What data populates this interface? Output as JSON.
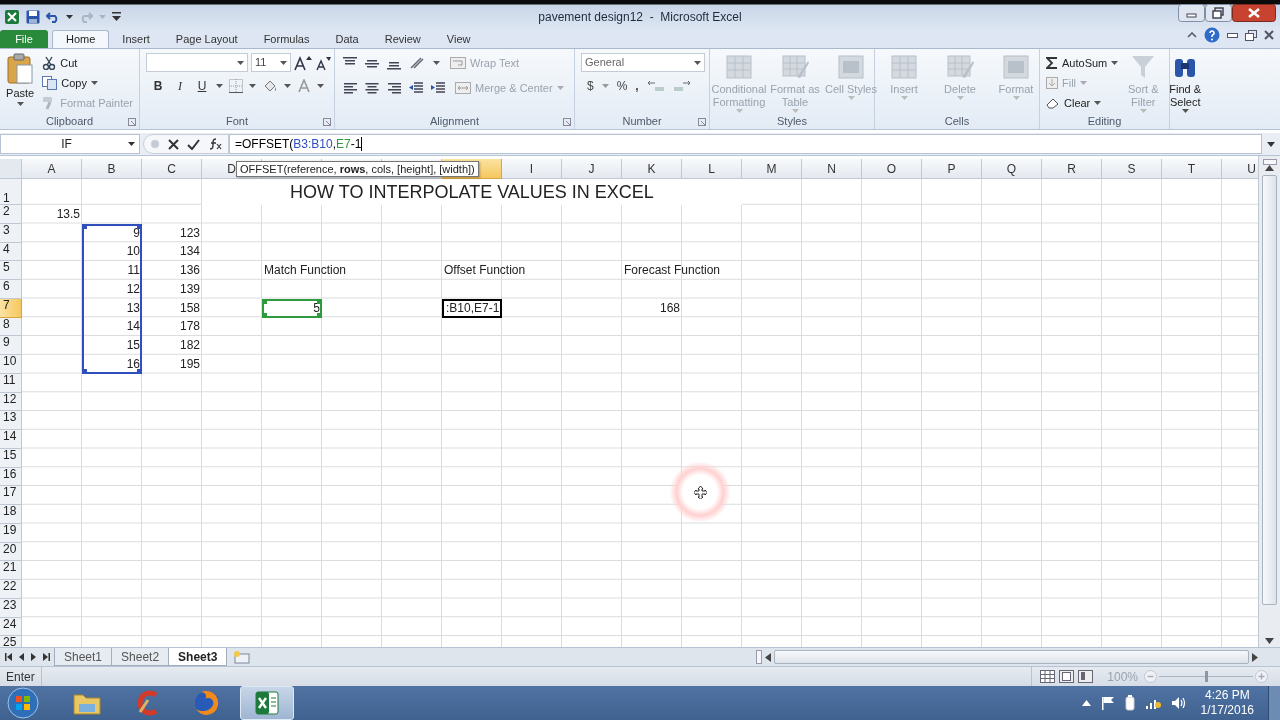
{
  "window": {
    "title": "pavement design12  -  Microsoft Excel"
  },
  "ribbon_tabs": [
    {
      "label": "File",
      "kind": "file",
      "selected": false
    },
    {
      "label": "Home",
      "kind": "tab",
      "selected": true
    },
    {
      "label": "Insert",
      "kind": "tab",
      "selected": false
    },
    {
      "label": "Page Layout",
      "kind": "tab",
      "selected": false
    },
    {
      "label": "Formulas",
      "kind": "tab",
      "selected": false
    },
    {
      "label": "Data",
      "kind": "tab",
      "selected": false
    },
    {
      "label": "Review",
      "kind": "tab",
      "selected": false
    },
    {
      "label": "View",
      "kind": "tab",
      "selected": false
    }
  ],
  "ribbon_groups": [
    {
      "label": "Clipboard",
      "kind": "clipboard",
      "launcher": true,
      "items": [
        {
          "label": "Paste",
          "disabled": false
        },
        {
          "label": "Cut",
          "disabled": false
        },
        {
          "label": "Copy",
          "disabled": false
        },
        {
          "label": "Format Painter",
          "disabled": true
        }
      ]
    },
    {
      "label": "Font",
      "kind": "font",
      "launcher": true,
      "font_size": "11",
      "items": [
        {
          "label": "B"
        },
        {
          "label": "I"
        },
        {
          "label": "U"
        }
      ]
    },
    {
      "label": "Alignment",
      "kind": "alignment",
      "launcher": true,
      "items": [
        {
          "label": "Wrap Text",
          "disabled": true
        },
        {
          "label": "Merge & Center",
          "disabled": true
        }
      ]
    },
    {
      "label": "Number",
      "kind": "number",
      "launcher": true,
      "format": "General",
      "items": [
        {
          "label": "$"
        },
        {
          "label": "%"
        },
        {
          "label": ","
        }
      ]
    },
    {
      "label": "Styles",
      "kind": "large",
      "launcher": false,
      "items": [
        {
          "label": "Conditional Formatting",
          "disabled": true
        },
        {
          "label": "Format as Table",
          "disabled": true
        },
        {
          "label": "Cell Styles",
          "disabled": true
        }
      ]
    },
    {
      "label": "Cells",
      "kind": "large",
      "launcher": false,
      "items": [
        {
          "label": "Insert",
          "disabled": true
        },
        {
          "label": "Delete",
          "disabled": true
        },
        {
          "label": "Format",
          "disabled": true
        }
      ]
    },
    {
      "label": "Editing",
      "kind": "editing",
      "launcher": false,
      "items": [
        {
          "label": "AutoSum",
          "kind": "small",
          "disabled": false
        },
        {
          "label": "Fill",
          "kind": "small",
          "disabled": true
        },
        {
          "label": "Clear",
          "kind": "small",
          "disabled": false
        },
        {
          "label": "Sort & Filter",
          "kind": "large",
          "disabled": true
        },
        {
          "label": "Find & Select",
          "kind": "large",
          "disabled": false
        }
      ]
    }
  ],
  "formula_bar": {
    "name_box": "IF",
    "formula_parts": [
      {
        "text": "=OFFSET(",
        "kind": "text"
      },
      {
        "text": "B3:B10",
        "kind": "reference",
        "color": "#2f4fbf"
      },
      {
        "text": ",",
        "kind": "text"
      },
      {
        "text": "E7",
        "kind": "reference",
        "color": "#2e9a3e"
      },
      {
        "text": "-1",
        "kind": "text"
      }
    ]
  },
  "tooltip": "OFFSET(reference, **rows**, cols, [height], [width])",
  "columns": [
    {
      "label": "A",
      "selected": false
    },
    {
      "label": "B",
      "selected": false
    },
    {
      "label": "C",
      "selected": false
    },
    {
      "label": "D",
      "selected": false
    },
    {
      "selected": false
    },
    {
      "selected": false
    },
    {
      "selected": false
    },
    {
      "selected": true
    },
    {
      "label": "I",
      "selected": false
    },
    {
      "label": "J",
      "selected": false
    },
    {
      "label": "K",
      "selected": false
    },
    {
      "label": "L",
      "selected": false
    },
    {
      "label": "M",
      "selected": false
    },
    {
      "label": "N",
      "selected": false
    },
    {
      "label": "O",
      "selected": false
    },
    {
      "label": "P",
      "selected": false
    },
    {
      "label": "Q",
      "selected": false
    },
    {
      "label": "R",
      "selected": false
    },
    {
      "label": "S",
      "selected": false
    },
    {
      "label": "T",
      "selected": false
    },
    {
      "label": "U",
      "selected": false
    }
  ],
  "rows": [
    {
      "label": "1",
      "selected": false,
      "cells": [
        {},
        {},
        {},
        {
          "kind": "title",
          "text": "HOW TO INTERPOLATE VALUES IN EXCEL"
        }
      ]
    },
    {
      "label": "2",
      "selected": false,
      "cells": [
        {
          "kind": "number",
          "text": "13.5"
        }
      ]
    },
    {
      "label": "3",
      "selected": false,
      "cells": [
        {},
        {
          "kind": "number",
          "text": "9"
        },
        {
          "kind": "number",
          "text": "123"
        }
      ]
    },
    {
      "label": "4",
      "selected": false,
      "cells": [
        {},
        {
          "kind": "number",
          "text": "10"
        },
        {
          "kind": "number",
          "text": "134"
        }
      ]
    },
    {
      "label": "5",
      "selected": false,
      "cells": [
        {},
        {
          "kind": "number",
          "text": "11"
        },
        {
          "kind": "number",
          "text": "136"
        },
        {},
        {
          "kind": "label",
          "text": "Match Function"
        },
        {},
        {},
        {
          "kind": "label",
          "text": "Offset Function"
        },
        {},
        {},
        {
          "kind": "label",
          "text": "Forecast Function"
        }
      ]
    },
    {
      "label": "6",
      "selected": false,
      "cells": [
        {},
        {
          "kind": "number",
          "text": "12"
        },
        {
          "kind": "number",
          "text": "139"
        }
      ]
    },
    {
      "label": "7",
      "selected": true,
      "cells": [
        {},
        {
          "kind": "number",
          "text": "13"
        },
        {
          "kind": "number",
          "text": "158"
        },
        {},
        {
          "kind": "number",
          "text": "5"
        },
        {},
        {},
        {
          "kind": "edit",
          "text": ":B10,E7-1"
        },
        {},
        {},
        {
          "kind": "number",
          "text": "168"
        }
      ]
    },
    {
      "label": "8",
      "selected": false,
      "cells": [
        {},
        {
          "kind": "number",
          "text": "14"
        },
        {
          "kind": "number",
          "text": "178"
        }
      ]
    },
    {
      "label": "9",
      "selected": false,
      "cells": [
        {},
        {
          "kind": "number",
          "text": "15"
        },
        {
          "kind": "number",
          "text": "182"
        }
      ]
    },
    {
      "label": "10",
      "selected": false,
      "cells": [
        {},
        {
          "kind": "number",
          "text": "16"
        },
        {
          "kind": "number",
          "text": "195"
        }
      ]
    },
    {
      "label": "11",
      "selected": false
    },
    {
      "label": "12",
      "selected": false
    },
    {
      "label": "13",
      "selected": false
    },
    {
      "label": "14",
      "selected": false
    },
    {
      "label": "15",
      "selected": false
    },
    {
      "label": "16",
      "selected": false
    },
    {
      "label": "17",
      "selected": false
    },
    {
      "label": "18",
      "selected": false
    },
    {
      "label": "19",
      "selected": false
    },
    {
      "label": "20",
      "selected": false
    },
    {
      "label": "21",
      "selected": false
    },
    {
      "label": "22",
      "selected": false
    },
    {
      "label": "23",
      "selected": false
    },
    {
      "label": "24",
      "selected": false
    },
    {
      "label": "25",
      "selected": false
    }
  ],
  "pointer_highlight": true,
  "sheet_tabs": [
    {
      "label": "Sheet1",
      "selected": false
    },
    {
      "label": "Sheet2",
      "selected": false
    },
    {
      "label": "Sheet3",
      "selected": true
    }
  ],
  "status_bar": {
    "mode": "Enter",
    "zoom": "100%",
    "zoom_slider": {
      "level": 0.5
    }
  },
  "taskbar": {
    "apps": [
      {
        "kind": "folder",
        "selected": false
      },
      {
        "kind": "cleaner",
        "selected": false
      },
      {
        "kind": "browser",
        "selected": false
      },
      {
        "kind": "spreadsheet",
        "selected": true
      }
    ],
    "time": "4:26 PM",
    "date": "1/17/2016"
  }
}
